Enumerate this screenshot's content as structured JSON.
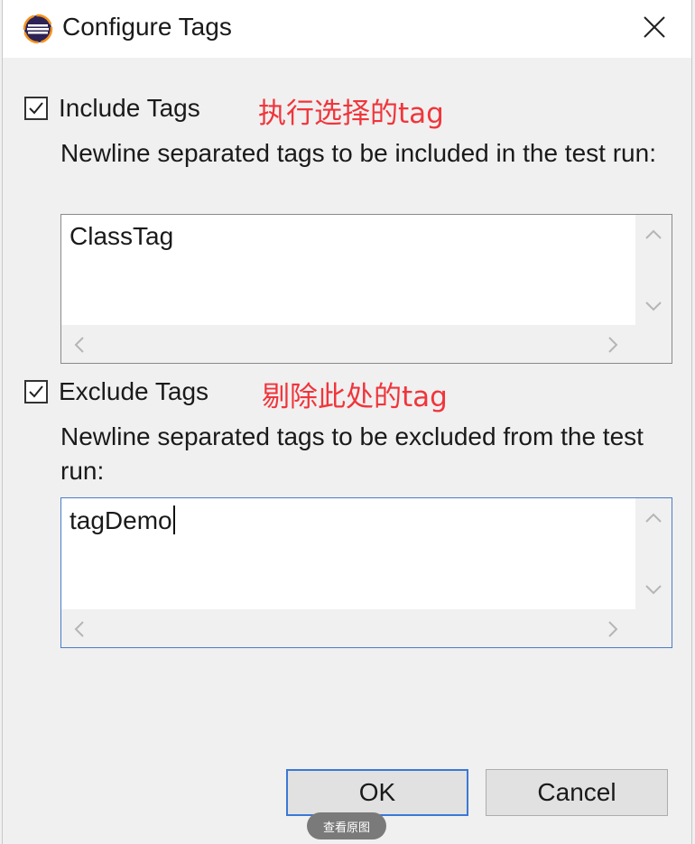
{
  "dialog": {
    "title": "Configure Tags",
    "close_icon": "close-icon",
    "app_icon": "eclipse-icon"
  },
  "include": {
    "checked": true,
    "label": "Include Tags",
    "annotation": "执行选择的tag",
    "description": "Newline separated tags to be included in the test run:",
    "value": "ClassTag"
  },
  "exclude": {
    "checked": true,
    "label": "Exclude Tags",
    "annotation": "剔除此处的tag",
    "description": "Newline separated tags to be excluded from the test run:",
    "value": "tagDemo"
  },
  "buttons": {
    "ok": "OK",
    "cancel": "Cancel"
  },
  "overlay": {
    "view_original": "查看原图"
  },
  "colors": {
    "annotation": "#f0353b",
    "focus_border": "#4a7cc9",
    "default_button_border": "#3b78d6"
  }
}
